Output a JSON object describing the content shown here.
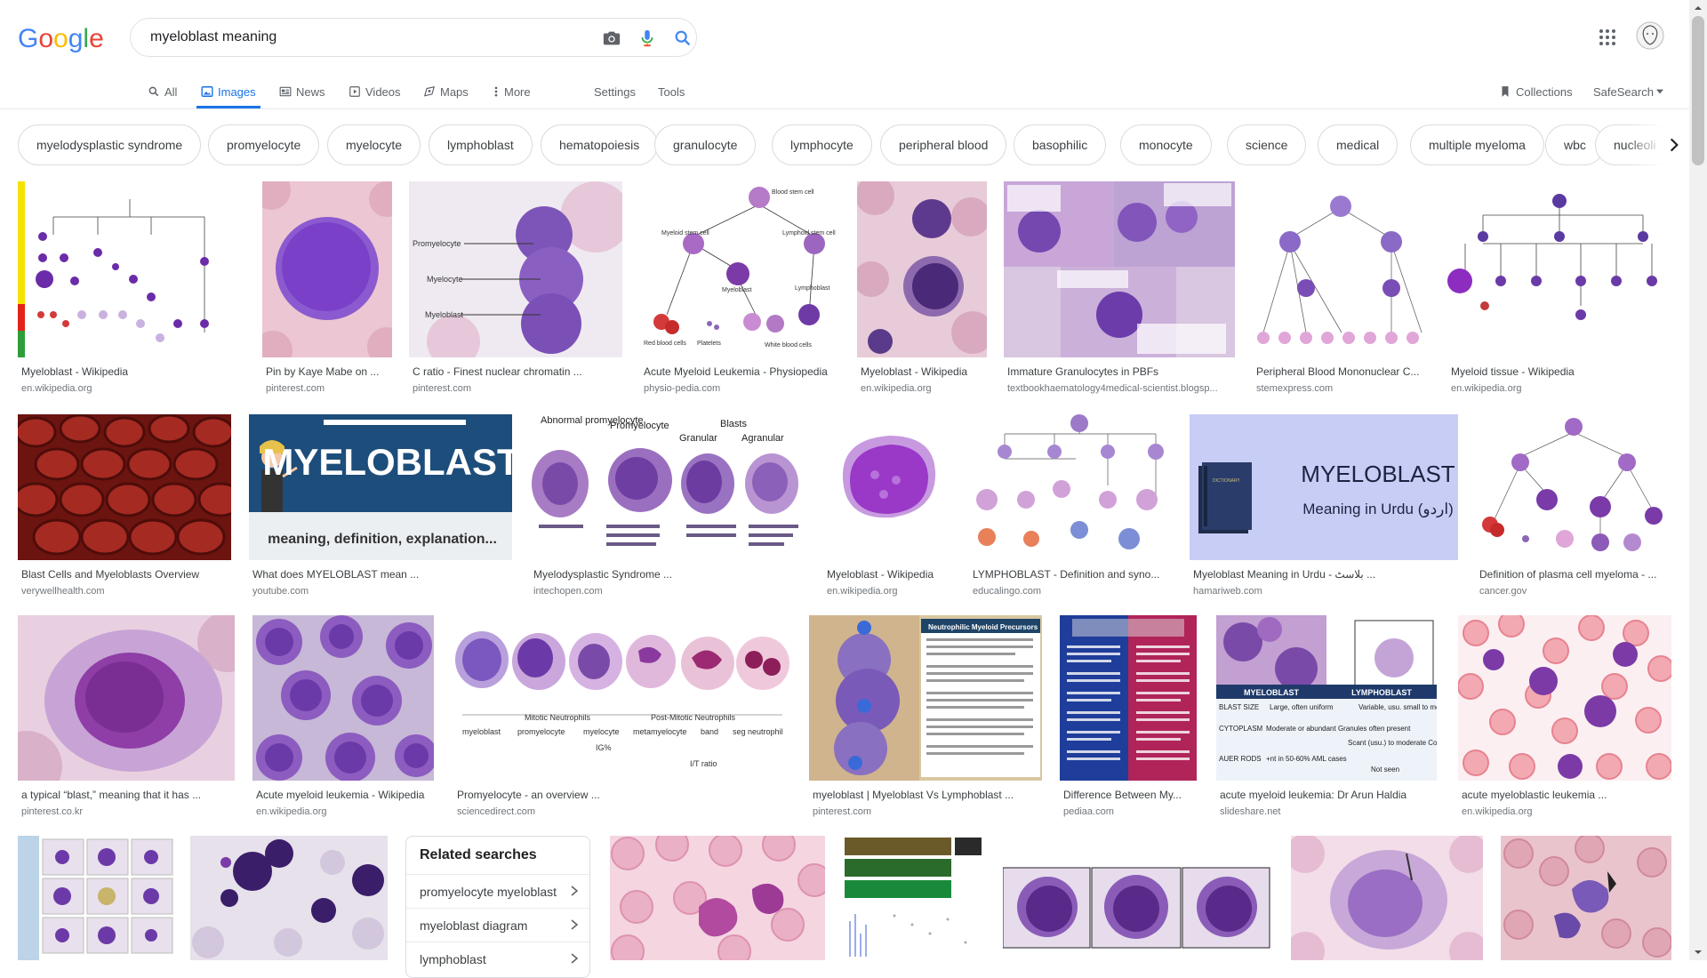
{
  "header": {
    "logo": "Google",
    "search_value": "myeloblast meaning",
    "icons": [
      "camera-icon",
      "microphone-icon",
      "search-icon",
      "apps-grid-icon",
      "avatar"
    ]
  },
  "tabs": [
    {
      "label": "All",
      "icon": "search-icon"
    },
    {
      "label": "Images",
      "icon": "image-icon",
      "active": true
    },
    {
      "label": "News",
      "icon": "news-icon"
    },
    {
      "label": "Videos",
      "icon": "video-icon"
    },
    {
      "label": "Maps",
      "icon": "map-pin-icon"
    },
    {
      "label": "More",
      "icon": "more-vertical-icon"
    },
    {
      "label": "Settings"
    },
    {
      "label": "Tools"
    },
    {
      "label": "Collections",
      "icon": "bookmark-icon"
    },
    {
      "label": "SafeSearch",
      "icon": "dropdown-arrow-icon"
    }
  ],
  "chips": [
    "myelodysplastic syndrome",
    "promyelocyte",
    "myelocyte",
    "lymphoblast",
    "hematopoiesis",
    "granulocyte",
    "lymphocyte",
    "peripheral blood",
    "basophilic",
    "monocyte",
    "science",
    "medical",
    "multiple myeloma",
    "wbc",
    "nucleoli"
  ],
  "results": [
    {
      "title": "Myeloblast - Wikipedia",
      "source": "en.wikipedia.org"
    },
    {
      "title": "Pin by Kaye Mabe on ...",
      "source": "pinterest.com"
    },
    {
      "title": "C ratio - Finest nuclear chromatin ...",
      "source": "pinterest.com"
    },
    {
      "title": "Acute Myeloid Leukemia - Physiopedia",
      "source": "physio-pedia.com"
    },
    {
      "title": "Myeloblast - Wikipedia",
      "source": "en.wikipedia.org"
    },
    {
      "title": "Immature Granulocytes in PBFs",
      "source": "textbookhaematology4medical-scientist.blogsp..."
    },
    {
      "title": "Peripheral Blood Mononuclear C...",
      "source": "stemexpress.com"
    },
    {
      "title": "Myeloid tissue - Wikipedia",
      "source": "en.wikipedia.org"
    },
    {
      "title": "Blast Cells and Myeloblasts Overview",
      "source": "verywellhealth.com"
    },
    {
      "title": "What does MYELOBLAST mean ...",
      "source": "youtube.com"
    },
    {
      "title": "Myelodysplastic Syndrome ...",
      "source": "intechopen.com"
    },
    {
      "title": "Myeloblast - Wikipedia",
      "source": "en.wikipedia.org"
    },
    {
      "title": "LYMPHOBLAST - Definition and syno...",
      "source": "educalingo.com"
    },
    {
      "title": "Myeloblast Meaning in Urdu - بلاسٹ ...",
      "source": "hamariweb.com"
    },
    {
      "title": "Definition of plasma cell myeloma - ...",
      "source": "cancer.gov"
    },
    {
      "title": "a typical “blast,” meaning that it has ...",
      "source": "pinterest.co.kr"
    },
    {
      "title": "Acute myeloid leukemia - Wikipedia",
      "source": "en.wikipedia.org"
    },
    {
      "title": "Promyelocyte - an overview ...",
      "source": "sciencedirect.com"
    },
    {
      "title": "myeloblast | Myeloblast Vs Lymphoblast ...",
      "source": "pinterest.com"
    },
    {
      "title": "Difference Between My...",
      "source": "pediaa.com"
    },
    {
      "title": "acute myeloid leukemia: Dr Arun Haldia",
      "source": "slideshare.net"
    },
    {
      "title": "acute myeloblastic leukemia ...",
      "source": "en.wikipedia.org"
    }
  ],
  "image_text": {
    "promyelocyte": "Promyelocyte",
    "myelocyte": "Myelocyte",
    "myeloblast": "Myeloblast",
    "blood_stem_cell": "Blood stem cell",
    "myeloid_stem_cell": "Myeloid stem cell",
    "lymphoid_stem_cell": "Lymphoid stem cell",
    "lymphoblast": "Lymphoblast",
    "red_blood_cells": "Red blood cells",
    "platelets": "Platelets",
    "white_blood_cells": "White blood cells",
    "myeloblast_banner": "MYELOBLAST",
    "banner_sub": "meaning, definition, explanation...",
    "abnormal_promyelocyte": "Abnormal promyelocyte",
    "promyelocyte2": "Promyelocyte",
    "blasts": "Blasts",
    "granular": "Granular",
    "agranular": "Agranular",
    "urdu_title": "MYELOBLAST",
    "urdu_sub": "Meaning in Urdu (اردو)",
    "table_h1": "MYELOBLAST",
    "table_h2": "LYMPHOBLAST",
    "blast_size": "BLAST SIZE",
    "blast_size_v1": "Large, often uniform",
    "blast_size_v2": "Variable, usu. small to medium size",
    "cytoplasm": "CYTOPLASM",
    "cytoplasm_v1": "Moderate or abundant Granules often present",
    "cytoplasm_v2": "Scant (usu.) to moderate Coarse granules sometimes +nt",
    "auer": "AUER RODS",
    "auer_v1": "+nt in 50-60% AML cases",
    "auer_v2": "Not seen",
    "neutrophilic": "Neutrophilic Myeloid Precursors",
    "mitotic": "Mitotic Neutrophils",
    "post_mitotic": "Post-Mitotic Neutrophils",
    "stages": [
      "myeloblast",
      "promyelocyte",
      "myelocyte",
      "metamyelocyte",
      "band",
      "seg neutrophil"
    ],
    "ig": "IG%",
    "it_ratio": "I/T ratio"
  },
  "related": {
    "title": "Related searches",
    "items": [
      "promyelocyte myeloblast",
      "myeloblast diagram",
      "lymphoblast"
    ]
  }
}
